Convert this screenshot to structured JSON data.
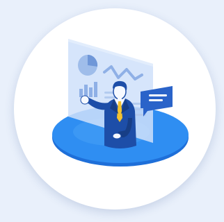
{
  "colors": {
    "page_background": "#e9f0fb",
    "card": "#ffffff",
    "platform": "#2f8ef2",
    "platform_dark": "#1e6fd9",
    "panel": "#cfe0fa",
    "panel_dark": "#9fbdea",
    "suit": "#1d4ea8",
    "suit_dark": "#173e86",
    "skin": "#f6f9ff",
    "tie": "#f2c230",
    "bubble": "#2a63c9"
  },
  "illustration": {
    "subject": "businessman-presenting-dashboard",
    "icons": [
      "pie-chart-icon",
      "bar-chart-icon",
      "line-chart-icon",
      "chat-bubble-icon"
    ]
  }
}
